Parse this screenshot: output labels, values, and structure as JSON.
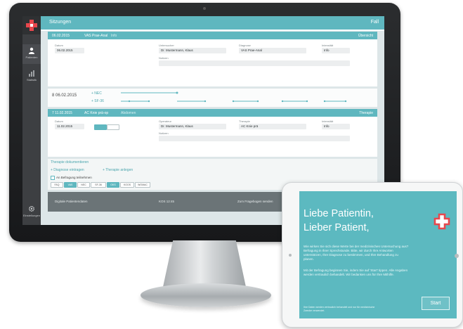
{
  "monitor": {
    "topbar": {
      "title": "Sitzungen",
      "right": "Fall"
    },
    "sidebar": [
      {
        "label": "Patienten",
        "icon": "user-icon"
      },
      {
        "label": "Statistik",
        "icon": "bar-chart-icon"
      },
      {
        "label": "Einstellungen",
        "icon": "gear-icon"
      }
    ],
    "section1": {
      "date": "06.02.2015",
      "title": "VAS Prae-Anal",
      "sub": "Info",
      "right": "Übersicht",
      "fields": [
        {
          "label": "Datum",
          "value": "06.02.2015"
        },
        {
          "label": "Untersucher",
          "value": "Dr. Mustermann, Klaus"
        },
        {
          "label": "Diagnose",
          "value": "VAS Prae-Anal"
        },
        {
          "label": "Intensität",
          "value": "Info"
        }
      ],
      "note_label": "Notizen"
    },
    "section2": {
      "date": "8 06.02.2015",
      "rows": [
        "+ NEC",
        "+ SF-36"
      ]
    },
    "section3": {
      "date": "7 11.02.2015",
      "title": "AC Knie prä-op",
      "sub": "Abdomen",
      "right": "Therapie",
      "fields": [
        {
          "label": "Datum",
          "value": "11.02.2015"
        },
        {
          "label": "Operateur",
          "value": "Dr. Mustermann, Klaus"
        },
        {
          "label": "Therapie",
          "value": "AC Knie prä"
        },
        {
          "label": "Intensität",
          "value": "Info"
        }
      ],
      "note_label": "Notizen"
    },
    "links": [
      "Therapie dokumentieren",
      "+ Diagnose eintragen",
      "+ Therapie anlegen"
    ],
    "survey": {
      "checkbox_label": "An Befragung teilnehmen",
      "chips": [
        "FAQ",
        "VAS",
        "NEC",
        "SF-36",
        "OKS",
        "KOOS",
        "WOMAC"
      ]
    },
    "footer": {
      "left": "Digitale Patientendaten",
      "mid": "KOS   12:45",
      "right": "Zum Fragebogen senden"
    }
  },
  "tablet": {
    "heading_line1": "Liebe Patientin,",
    "heading_line2": "Lieber Patient,",
    "para1": "Wie wirken Sie sich diese Werte bei der medizinischen Untersuchung aus? Befragung in Ihrer Sprechstunde. Bitte, wir durch Ihre Antworten unterstützen, Ihre Diagnose zu bestimmen, und Ihre Behandlung zu planen.",
    "para2": "Mit der Befragung beginnen Sie, indem Sie auf 'Start' tippen. Alle Angaben werden vertraulich behandelt. Wir bedanken uns für Ihre Mithilfe.",
    "fine_print": "Ihre Daten werden vertraulich behandelt und nur für medizinische Zwecke verwendet.",
    "start_label": "Start"
  }
}
